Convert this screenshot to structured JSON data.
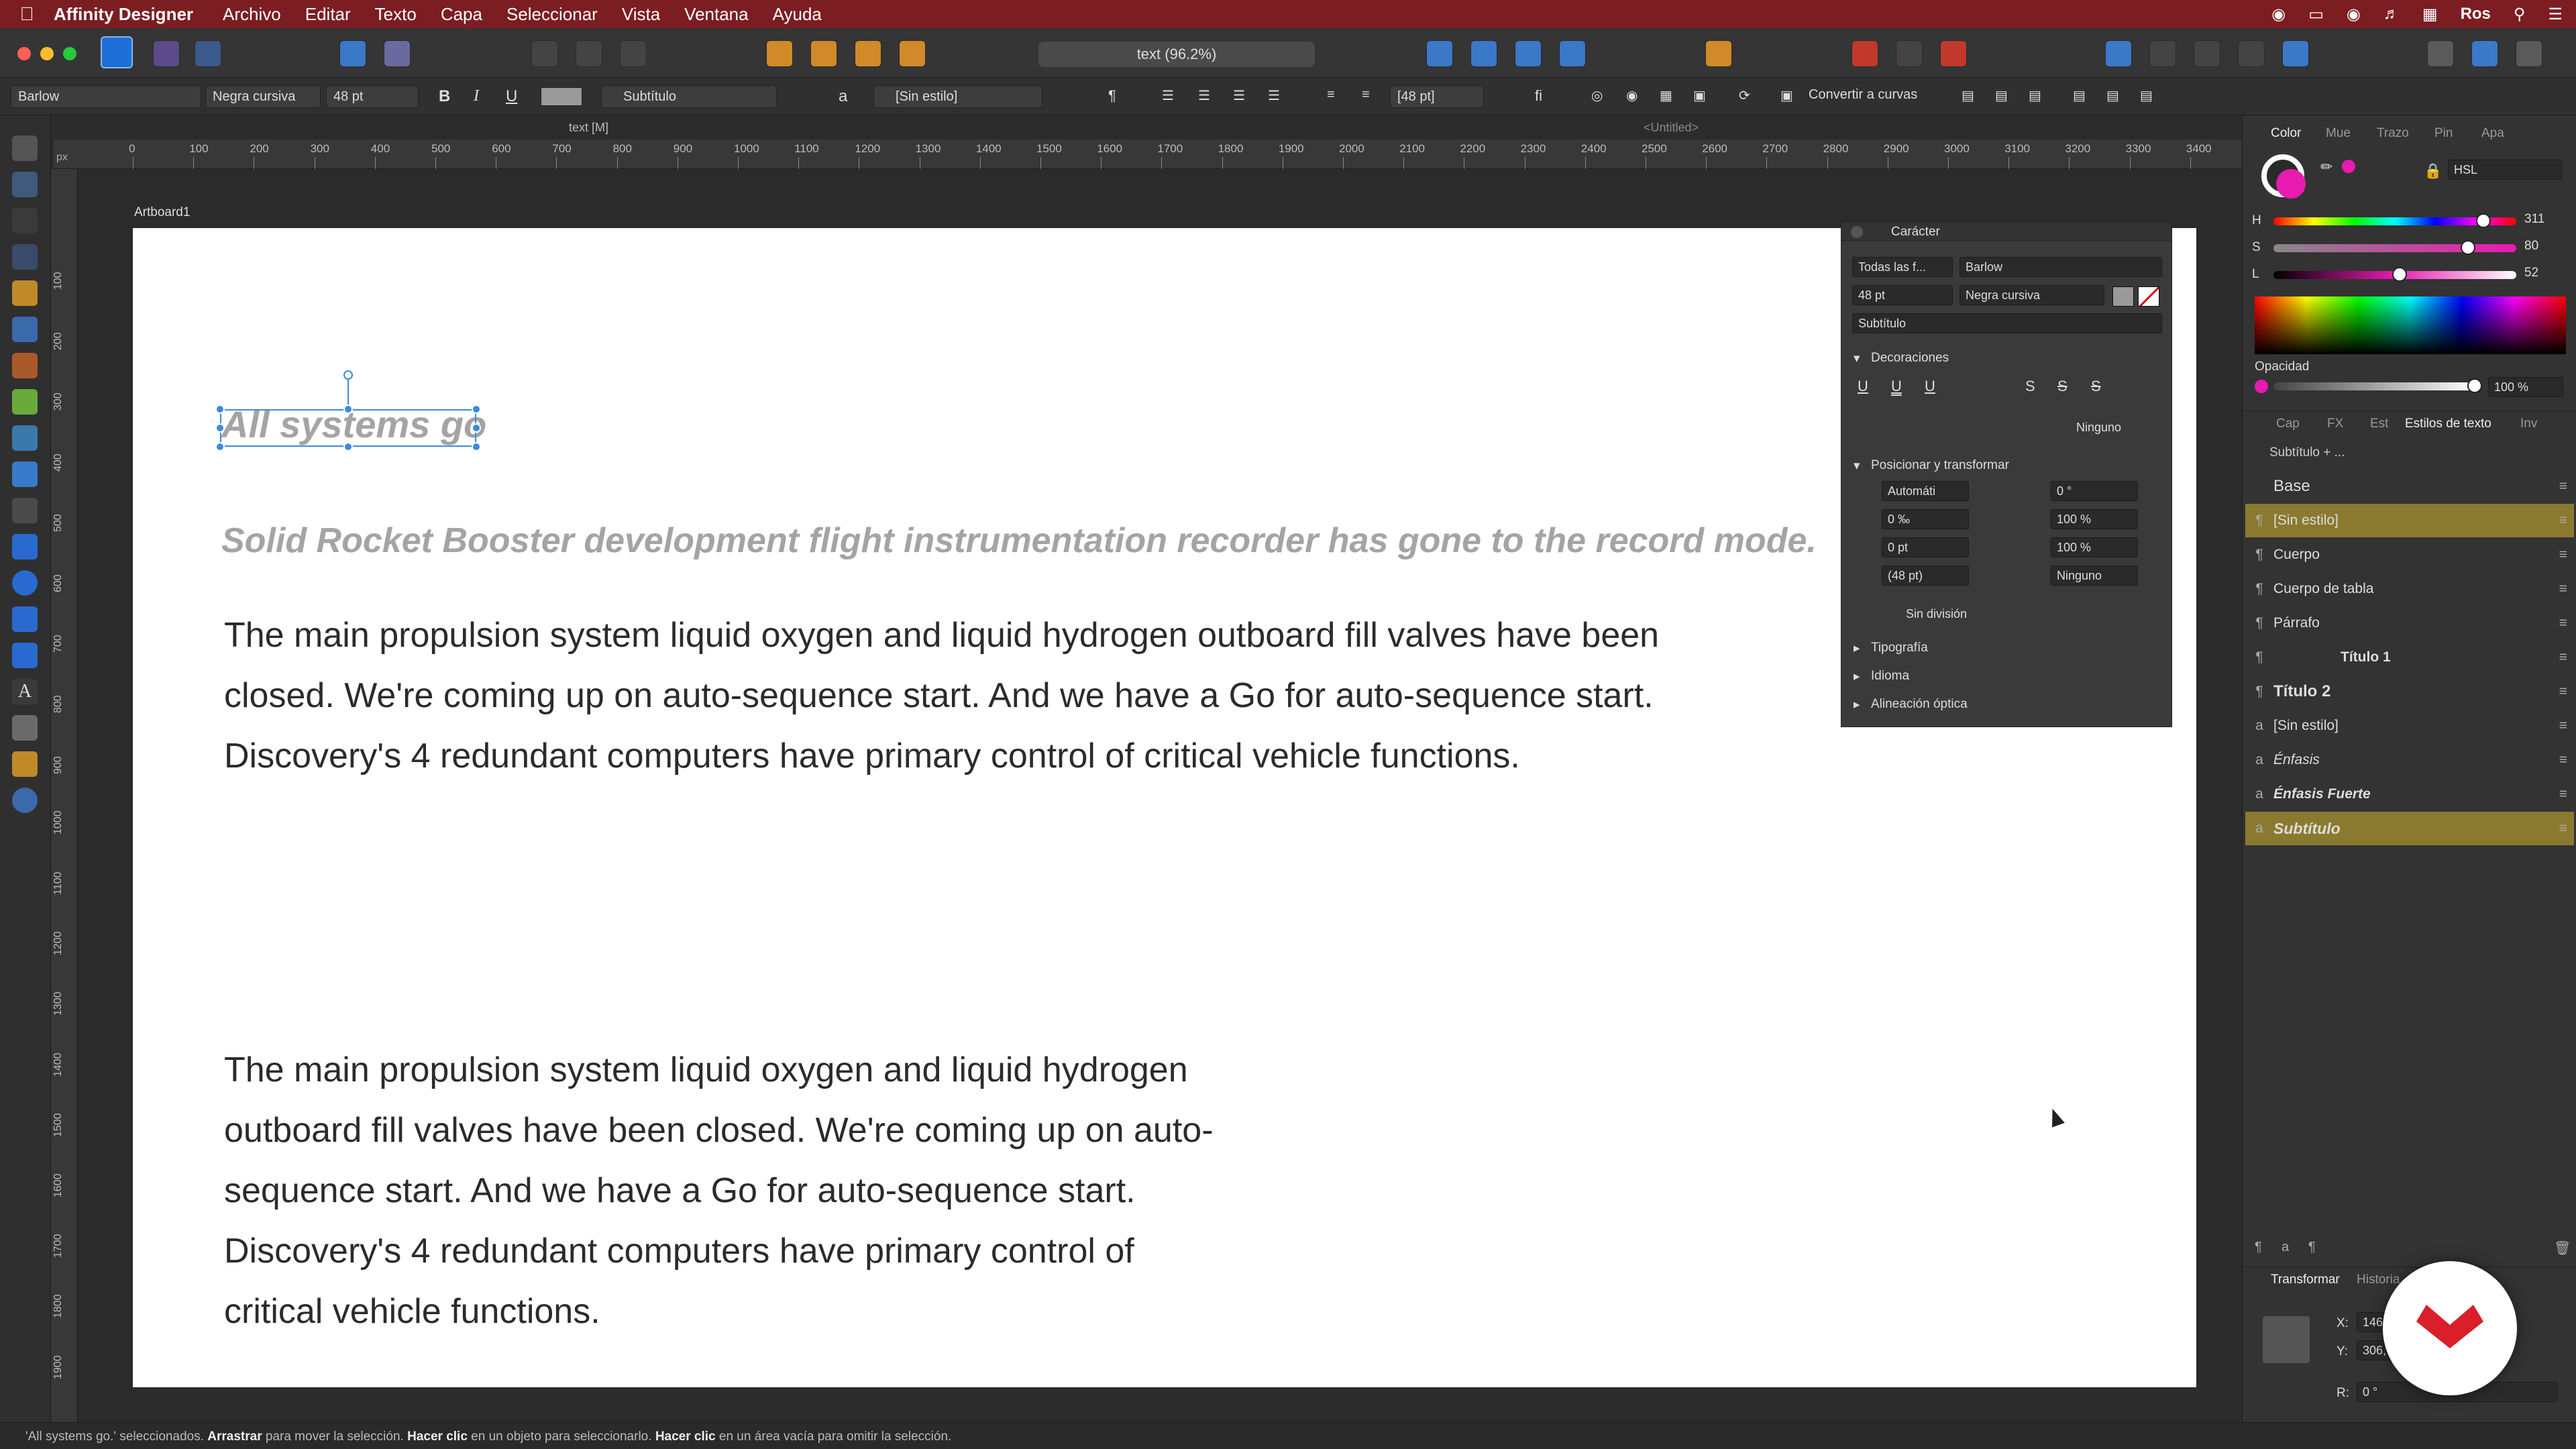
{
  "menubar": {
    "app_name": "Affinity Designer",
    "items": [
      "Archivo",
      "Editar",
      "Texto",
      "Capa",
      "Seleccionar",
      "Vista",
      "Ventana",
      "Ayuda"
    ],
    "user": "Ros"
  },
  "toolbar": {
    "doc_title": "text (96.2%)",
    "convert_label": "Convertir a curvas"
  },
  "context_bar": {
    "font_family": "Barlow",
    "font_style": "Negra cursiva",
    "font_size": "48 pt",
    "bold": "B",
    "italic": "I",
    "underline": "U",
    "para_style": "Subtítulo",
    "char_style": "[Sin estilo]",
    "leading": "[48 pt]",
    "char_a": "a"
  },
  "tabs": {
    "doc_tab": "text [M]",
    "untitled_tab": "<Untitled>"
  },
  "ruler": {
    "unit": "px",
    "h_ticks": [
      "0",
      "100",
      "200",
      "300",
      "400",
      "500",
      "600",
      "700",
      "800",
      "900",
      "1000",
      "1100",
      "1200",
      "1300",
      "1400",
      "1500",
      "1600",
      "1700",
      "1800",
      "1900",
      "2000",
      "2100",
      "2200",
      "2300",
      "2400",
      "2500",
      "2600",
      "2700",
      "2800",
      "2900",
      "3000",
      "3100",
      "3200",
      "3300",
      "3400"
    ],
    "v_ticks": [
      "100",
      "200",
      "300",
      "400",
      "500",
      "600",
      "700",
      "800",
      "900",
      "1000",
      "1100",
      "1200",
      "1300",
      "1400",
      "1500",
      "1600",
      "1700",
      "1800",
      "1900"
    ]
  },
  "artboard": {
    "label": "Artboard1",
    "heading": "All systems go",
    "subtitle": "Solid Rocket Booster development flight instrumentation recorder has gone to the record mode.",
    "para1": [
      "The main propulsion system liquid oxygen and liquid hydrogen outboard fill valves have been",
      "closed. We're coming up on auto-sequence start. And we have a Go for auto-sequence start.",
      "Discovery's 4 redundant computers have primary control of critical vehicle functions."
    ],
    "para2": [
      "The main propulsion system liquid oxygen and liquid hydrogen",
      "outboard fill valves have been closed. We're coming up on auto-",
      "sequence start. And we have a Go for auto-sequence start.",
      "Discovery's 4 redundant computers have primary control of",
      "critical vehicle functions."
    ]
  },
  "character_panel": {
    "title": "Carácter",
    "font_scope": "Todas las f...",
    "family": "Barlow",
    "size": "48 pt",
    "style": "Negra cursiva",
    "para_style": "Subtítulo",
    "decorations": "Decoraciones",
    "none": "Ninguno",
    "position_transform": "Posicionar y transformar",
    "kerning": "Automáti",
    "tracking": "0 ‰",
    "baseline": "0 pt",
    "leading": "(48 pt)",
    "skew": "0 °",
    "h_scale": "100 %",
    "v_scale": "100 %",
    "nohyph": "Ninguno",
    "no_break": "Sin división",
    "typography": "Tipografía",
    "language": "Idioma",
    "optical": "Alineación óptica"
  },
  "right_panel": {
    "tabs": [
      "Color",
      "Mue",
      "Trazo",
      "Pin",
      "Apa"
    ],
    "color_model": "HSL",
    "H": "311",
    "S": "80",
    "L": "52",
    "hsl_levels": {
      "H": 0.864,
      "S": 0.8,
      "L": 0.52,
      "opacity": 1.0
    },
    "opacity_label": "Opacidad",
    "opacity": "100 %",
    "accent_color": "#e81ab0",
    "tabs2": [
      "Cap",
      "FX",
      "Est",
      "Estilos de texto",
      "Inv"
    ],
    "style_group": "Subtítulo + ...",
    "styles": [
      {
        "icon": "",
        "name": "Base"
      },
      {
        "icon": "¶",
        "name": "[Sin estilo]"
      },
      {
        "icon": "¶",
        "name": "Cuerpo"
      },
      {
        "icon": "¶",
        "name": "Cuerpo de tabla"
      },
      {
        "icon": "¶",
        "name": "Párrafo"
      },
      {
        "icon": "¶",
        "name": "Título 1"
      },
      {
        "icon": "¶",
        "name": "Título 2"
      },
      {
        "icon": "a",
        "name": "[Sin estilo]"
      },
      {
        "icon": "a",
        "name": "Énfasis"
      },
      {
        "icon": "a",
        "name": "Énfasis Fuerte"
      },
      {
        "icon": "a",
        "name": "Subtítulo"
      }
    ],
    "transform_tab": "Transformar",
    "history_tab": "Historia",
    "x_label": "X:",
    "x_value": "146,",
    "y_label": "Y:",
    "y_value": "306,",
    "r_label": "R:",
    "r_value": "0 °"
  },
  "statusbar": {
    "sel": "'All systems go.' seleccionados.",
    "drag": "Arrastrar",
    "drag_t": "para mover la selección.",
    "click": "Hacer clic",
    "click_t": "en un objeto para seleccionarlo.",
    "click2": "Hacer clic",
    "click2_t": "en un área vacía para omitir la selección."
  }
}
